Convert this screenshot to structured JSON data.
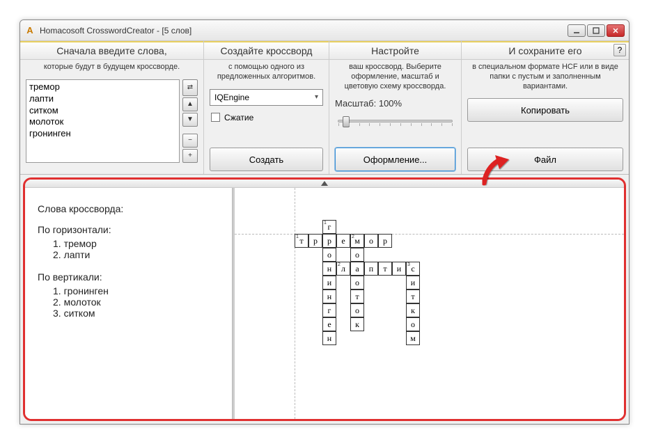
{
  "title": "Homacosoft CrosswordCreator - [5 слов]",
  "app_icon_letter": "A",
  "panel1": {
    "head": "Сначала введите слова,",
    "desc": "которые будут в будущем кроссворде.",
    "words_text": "тремор\nлапти\nситком\nмолоток\nгронинген",
    "btn_swap": "⇄",
    "btn_up": "▲",
    "btn_down": "▼",
    "btn_minus": "−",
    "btn_plus": "+"
  },
  "panel2": {
    "head": "Создайте кроссворд",
    "desc": "с помощью одного из предложенных алгоритмов.",
    "engine": "IQEngine",
    "compress": "Сжатие",
    "create": "Создать"
  },
  "panel3": {
    "head": "Настройте",
    "desc": "ваш кроссворд. Выберите оформление, масштаб и цветовую схему кроссворда.",
    "scale": "Масштаб: 100%",
    "design": "Оформление..."
  },
  "panel4": {
    "head": "И сохраните его",
    "desc": "в специальном формате HCF или в виде папки с пустым и заполненным вариантами.",
    "copy": "Копировать",
    "file": "Файл",
    "help": "?"
  },
  "clues": {
    "title": "Слова кроссворда:",
    "across_label": "По горизонтали:",
    "across": [
      "1. тремор",
      "2. лапти"
    ],
    "down_label": "По вертикали:",
    "down": [
      "1. гронинген",
      "2. молоток",
      "3. ситком"
    ]
  },
  "grid": {
    "cells": [
      {
        "r": 0,
        "c": 2,
        "ch": "г",
        "num": "1"
      },
      {
        "r": 1,
        "c": 0,
        "ch": "т",
        "num": "1"
      },
      {
        "r": 1,
        "c": 1,
        "ch": "р"
      },
      {
        "r": 1,
        "c": 2,
        "ch": "р"
      },
      {
        "r": 1,
        "c": 3,
        "ch": "е"
      },
      {
        "r": 1,
        "c": 4,
        "ch": "м",
        "num": "2"
      },
      {
        "r": 1,
        "c": 5,
        "ch": "о"
      },
      {
        "r": 1,
        "c": 6,
        "ch": "р"
      },
      {
        "r": 2,
        "c": 2,
        "ch": "о"
      },
      {
        "r": 2,
        "c": 4,
        "ch": "о"
      },
      {
        "r": 3,
        "c": 2,
        "ch": "н"
      },
      {
        "r": 3,
        "c": 3,
        "ch": "л",
        "num": "2"
      },
      {
        "r": 3,
        "c": 4,
        "ch": "а"
      },
      {
        "r": 3,
        "c": 5,
        "ch": "п"
      },
      {
        "r": 3,
        "c": 6,
        "ch": "т"
      },
      {
        "r": 3,
        "c": 7,
        "ch": "и"
      },
      {
        "r": 3,
        "c": 8,
        "ch": "с",
        "num": "3"
      },
      {
        "r": 4,
        "c": 2,
        "ch": "и"
      },
      {
        "r": 4,
        "c": 4,
        "ch": "о"
      },
      {
        "r": 4,
        "c": 8,
        "ch": "и"
      },
      {
        "r": 5,
        "c": 2,
        "ch": "н"
      },
      {
        "r": 5,
        "c": 4,
        "ch": "т"
      },
      {
        "r": 5,
        "c": 8,
        "ch": "т"
      },
      {
        "r": 6,
        "c": 2,
        "ch": "г"
      },
      {
        "r": 6,
        "c": 4,
        "ch": "о"
      },
      {
        "r": 6,
        "c": 8,
        "ch": "к"
      },
      {
        "r": 7,
        "c": 2,
        "ch": "е"
      },
      {
        "r": 7,
        "c": 4,
        "ch": "к"
      },
      {
        "r": 7,
        "c": 8,
        "ch": "о"
      },
      {
        "r": 8,
        "c": 2,
        "ch": "н"
      },
      {
        "r": 8,
        "c": 8,
        "ch": "м"
      }
    ]
  }
}
